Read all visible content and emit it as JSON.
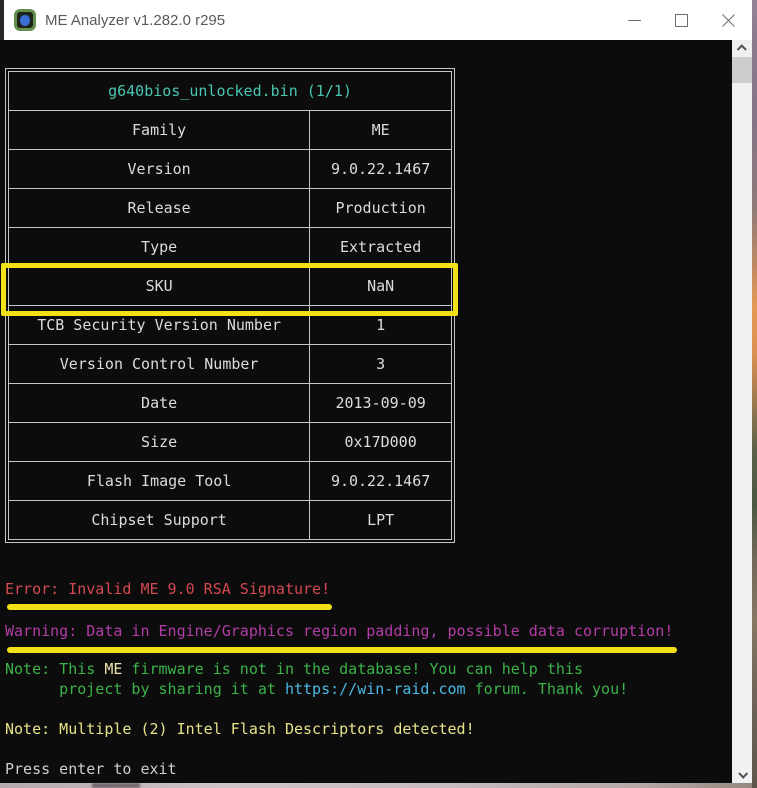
{
  "window": {
    "title": "ME Analyzer v1.282.0 r295",
    "icons": [
      "app-chip-icon",
      "minimize-icon",
      "maximize-icon",
      "close-icon",
      "scroll-up-icon",
      "scroll-down-icon"
    ]
  },
  "table": {
    "header": "g640bios_unlocked.bin (1/1)",
    "rows": [
      {
        "label": "Family",
        "value": "ME"
      },
      {
        "label": "Version",
        "value": "9.0.22.1467"
      },
      {
        "label": "Release",
        "value": "Production"
      },
      {
        "label": "Type",
        "value": "Extracted"
      },
      {
        "label": "SKU",
        "value": "NaN",
        "highlighted": true
      },
      {
        "label": "TCB Security Version Number",
        "value": "1"
      },
      {
        "label": "Version Control Number",
        "value": "3"
      },
      {
        "label": "Date",
        "value": "2013-09-09"
      },
      {
        "label": "Size",
        "value": "0x17D000"
      },
      {
        "label": "Flash Image Tool",
        "value": "9.0.22.1467"
      },
      {
        "label": "Chipset Support",
        "value": "LPT"
      }
    ]
  },
  "messages": {
    "error": "Error: Invalid ME 9.0 RSA Signature!",
    "warning": "Warning: Data in Engine/Graphics region padding, possible data corruption!",
    "note_db_seg1": "Note: This ",
    "note_db_seg2": "ME",
    "note_db_seg3": " firmware is not in the database! You can help this",
    "note_db_line2_seg1": "      project by sharing it at ",
    "note_db_line2_link": "https://win-raid.com",
    "note_db_line2_seg3": " forum. Thank you!",
    "note_fd": "Note: Multiple (2) Intel Flash Descriptors detected!",
    "prompt": "Press enter to exit"
  },
  "colors": {
    "console_background": "#0c0c0c",
    "table_border": "#c6c6c6",
    "table_text": "#dcdcdc",
    "header_teal": "#49c5b1",
    "error_red": "#d24950",
    "warning_magenta": "#b23ca6",
    "note_green": "#3bb24a",
    "link_cyan": "#4cb8e6",
    "note_pale_yellow": "#e6e28a",
    "annotation_yellow": "#f2e118"
  }
}
